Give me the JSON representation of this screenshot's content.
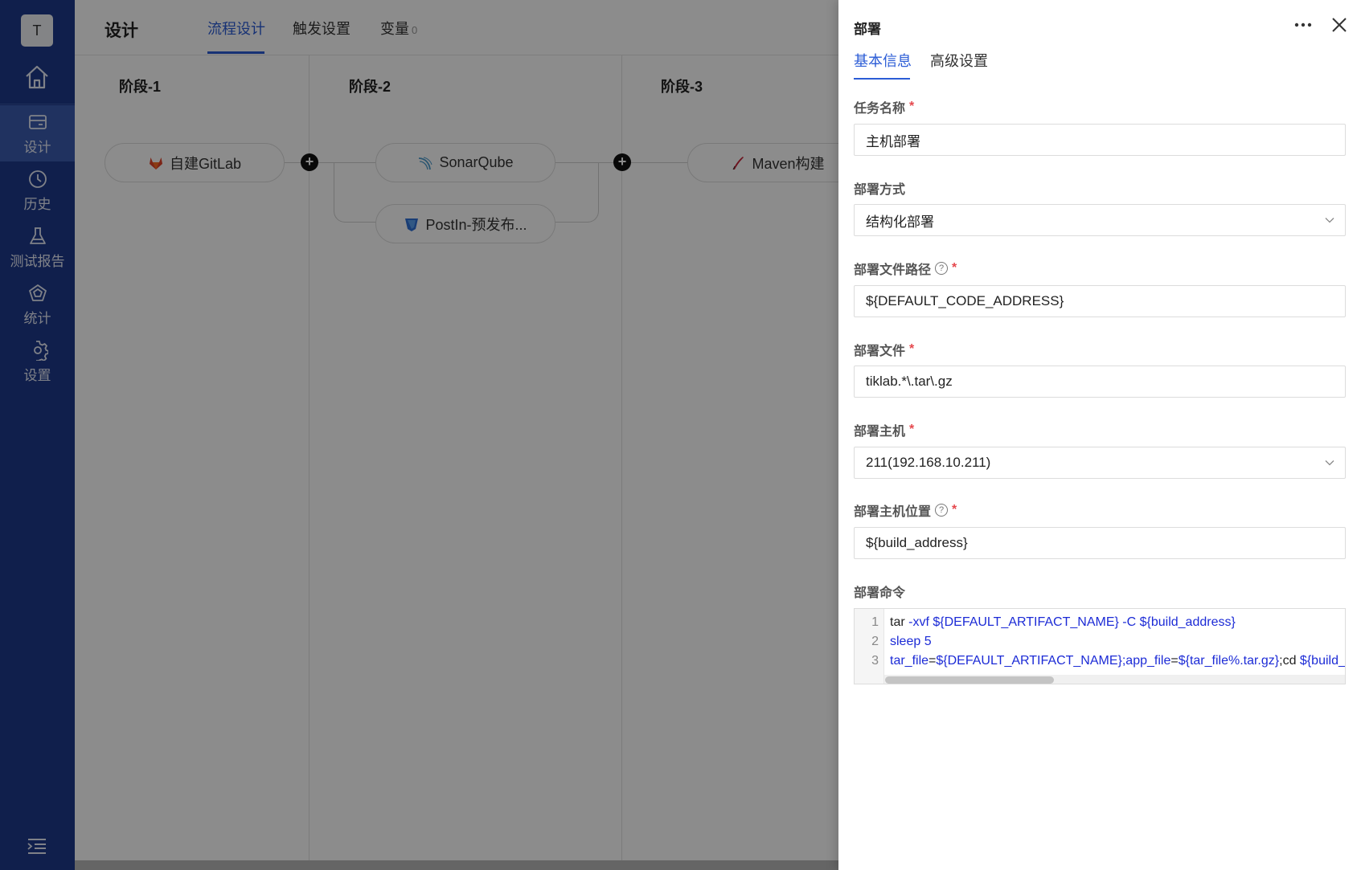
{
  "sidebar": {
    "avatar": "T",
    "items": [
      {
        "label": "设计",
        "icon": "design-icon",
        "active": true
      },
      {
        "label": "历史",
        "icon": "clock-icon",
        "active": false
      },
      {
        "label": "测试报告",
        "icon": "flask-icon",
        "active": false
      },
      {
        "label": "统计",
        "icon": "stats-icon",
        "active": false
      },
      {
        "label": "设置",
        "icon": "gear-icon",
        "active": false
      }
    ]
  },
  "header": {
    "title": "设计",
    "tabs": [
      {
        "label": "流程设计",
        "active": true
      },
      {
        "label": "触发设置",
        "active": false
      },
      {
        "label": "变量",
        "count": "0",
        "active": false
      }
    ]
  },
  "pipeline": {
    "stages": [
      {
        "title": "阶段-1",
        "jobs": [
          "自建GitLab"
        ]
      },
      {
        "title": "阶段-2",
        "jobs": [
          "SonarQube",
          "PostIn-预发布..."
        ]
      },
      {
        "title": "阶段-3",
        "jobs": [
          "Maven构建"
        ]
      }
    ]
  },
  "drawer": {
    "title": "部署",
    "tabs": [
      {
        "label": "基本信息",
        "active": true
      },
      {
        "label": "高级设置",
        "active": false
      }
    ],
    "fields": {
      "task_name": {
        "label": "任务名称",
        "value": "主机部署",
        "required": true
      },
      "deploy_mode": {
        "label": "部署方式",
        "value": "结构化部署"
      },
      "deploy_path": {
        "label": "部署文件路径",
        "value": "${DEFAULT_CODE_ADDRESS}",
        "required": true
      },
      "deploy_file": {
        "label": "部署文件",
        "value": "tiklab.*\\.tar\\.gz",
        "required": true
      },
      "deploy_host": {
        "label": "部署主机",
        "value": "211(192.168.10.211)",
        "required": true
      },
      "host_location": {
        "label": "部署主机位置",
        "value": "${build_address}",
        "required": true
      },
      "command": {
        "label": "部署命令"
      }
    },
    "code": {
      "line_numbers": [
        "1",
        "2",
        "3"
      ],
      "line1": {
        "a": "tar ",
        "b": "-xvf  ${DEFAULT_ARTIFACT_NAME} -C ${build_address}"
      },
      "line2": {
        "a": "sleep 5"
      },
      "line3": {
        "a": "tar_file",
        "b": "=",
        "c": "${DEFAULT_ARTIFACT_NAME};app_file",
        "d": "=",
        "e": "${tar_file%.tar.gz}",
        ";cd": ";cd ",
        "f": "${build_address}"
      }
    }
  },
  "colors": {
    "primary": "#2b5cd6",
    "sidebar": "#1e3a8a",
    "required": "#e5484d"
  }
}
